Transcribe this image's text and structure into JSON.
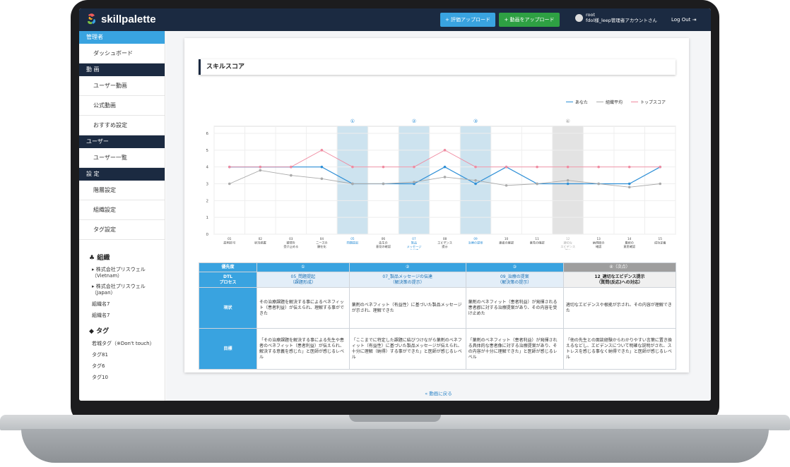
{
  "app": {
    "logo": "skillpalette"
  },
  "topbar": {
    "eval_button": "+ 評価アップロード",
    "video_button": "+ 動画をアップロード",
    "user_line1": "root",
    "user_line2": "fdol様_leep管理者アカウントさん",
    "logout": "Log Out"
  },
  "sidebar": {
    "sec_admin": "管理者",
    "dashboard": "ダッシュボード",
    "sec_video": "動 画",
    "user_video": "ユーザー動画",
    "official_video": "公式動画",
    "recommend": "おすすめ設定",
    "sec_user": "ユーザー",
    "user_list": "ユーザー一覧",
    "sec_settings": "設 定",
    "hierarchy": "階層設定",
    "org_settings": "組織設定",
    "tag_settings": "タグ設定",
    "org_head": "組織",
    "orgs": [
      "株式会社プリスウェル（Vietnam）",
      "株式会社プリスウェル（Japan）"
    ],
    "org_names": [
      "組織名7",
      "組織名7"
    ],
    "tag_head": "タグ",
    "tags": [
      "若城タグ（※Don't touch）",
      "タグ81",
      "タグ6",
      "タグ10"
    ]
  },
  "main": {
    "section_title": "スキルスコア",
    "back_link": "« 動画に戻る"
  },
  "chart_data": {
    "type": "line",
    "legend": [
      "あなた",
      "組織平均",
      "トップスコア"
    ],
    "colors": {
      "you": "#2e8fd6",
      "avg": "#aaaaaa",
      "top": "#f08aa0",
      "highlight": "#cde3ef",
      "grey": "#e3e3e3"
    },
    "ylim": [
      0,
      6
    ],
    "yticks": [
      "0",
      "1",
      "2",
      "3",
      "4",
      "5",
      "6"
    ],
    "categories": [
      [
        "01",
        "説明許可"
      ],
      [
        "02",
        "状況把握"
      ],
      [
        "03",
        "疑問を",
        "受け止める"
      ],
      [
        "04",
        "ニーズの",
        "顕在化"
      ],
      [
        "05",
        "問題提起"
      ],
      [
        "06",
        "先生の",
        "意見の確認"
      ],
      [
        "07",
        "製品",
        "メッセージ",
        "の伝達"
      ],
      [
        "08",
        "エビデンス",
        "提示"
      ],
      [
        "09",
        "治療の提案"
      ],
      [
        "10",
        "患者の確認"
      ],
      [
        "11",
        "意見の確認"
      ],
      [
        "12",
        "適切な",
        "エビデンス",
        "提示"
      ],
      [
        "13",
        "納得度の",
        "確認"
      ],
      [
        "14",
        "最終の",
        "意思確認"
      ],
      [
        "15",
        "成功定着"
      ]
    ],
    "highlights": [
      {
        "index": 4,
        "label": "①",
        "style": "blue"
      },
      {
        "index": 6,
        "label": "②",
        "style": "blue"
      },
      {
        "index": 8,
        "label": "③",
        "style": "blue"
      },
      {
        "index": 11,
        "label": "④",
        "style": "grey"
      }
    ],
    "series": [
      {
        "name": "あなた",
        "values": [
          4,
          4,
          4,
          4,
          3,
          3,
          3,
          4,
          3,
          4,
          3,
          3,
          3,
          3,
          4
        ]
      },
      {
        "name": "組織平均",
        "values": [
          3,
          3.8,
          3.5,
          3.3,
          3,
          3,
          3.1,
          3.4,
          3.2,
          2.9,
          3,
          3.2,
          3,
          2.8,
          3
        ]
      },
      {
        "name": "トップスコア",
        "values": [
          4,
          4,
          4,
          5,
          4,
          4,
          4,
          5,
          4,
          4,
          4,
          4,
          4,
          4,
          4
        ]
      }
    ]
  },
  "table": {
    "priority_label": "優先度",
    "process_label": "DTL\nプロセス",
    "current_label": "現状",
    "goal_label": "目標",
    "cols": [
      {
        "head": "①",
        "process": "05_問題提起\n（課題形成）",
        "current": "その治療課題を解決する事によるベネフィット（患者利益）が伝えられ、理解する事ができた",
        "goal": "「その治療課題を解決する事による先生や患者のベネフィット（患者利益）が伝えられ、解決する意義を感じた」と医師が感じるレベル"
      },
      {
        "head": "②",
        "process": "07_製品メッセージの伝達\n（解決策の提示）",
        "current": "薬剤のベネフィット（有益性）に基づいた製品メッセージが示され、理解できた",
        "goal": "「ここまでに特定した課題に結びつけながら薬剤のベネフィット（有益性）に基づいた製品メッセージが伝えられ、十分に理解（納得）する事ができた」と医師が感じるレベル"
      },
      {
        "head": "③",
        "process": "09_治療の提案\n（解決策の提示）",
        "current": "薬剤のベネフィット（患者利益）が発揮される患者郡に対する治療提案があり、その内容を受け止めた",
        "goal": "「薬剤のベネフィット（患者利益）が発揮される具体的な患者像に対する治療提案があり、その内容が十分に理解できた」と医師が感じるレベル"
      },
      {
        "head": "④（次点）",
        "process": "12_適切なエビデンス提示\n（質問(反応)への対応）",
        "current": "適切なエビデンスや根拠が示され、その内容が理解できた",
        "goal": "「他の先生との面談経験からわかりやすい言葉に置き換えるなどし、エビデンスについて明確な説明がされ、ストレスを感じる事なく納得できた」と医師が感じるレベル"
      }
    ]
  }
}
